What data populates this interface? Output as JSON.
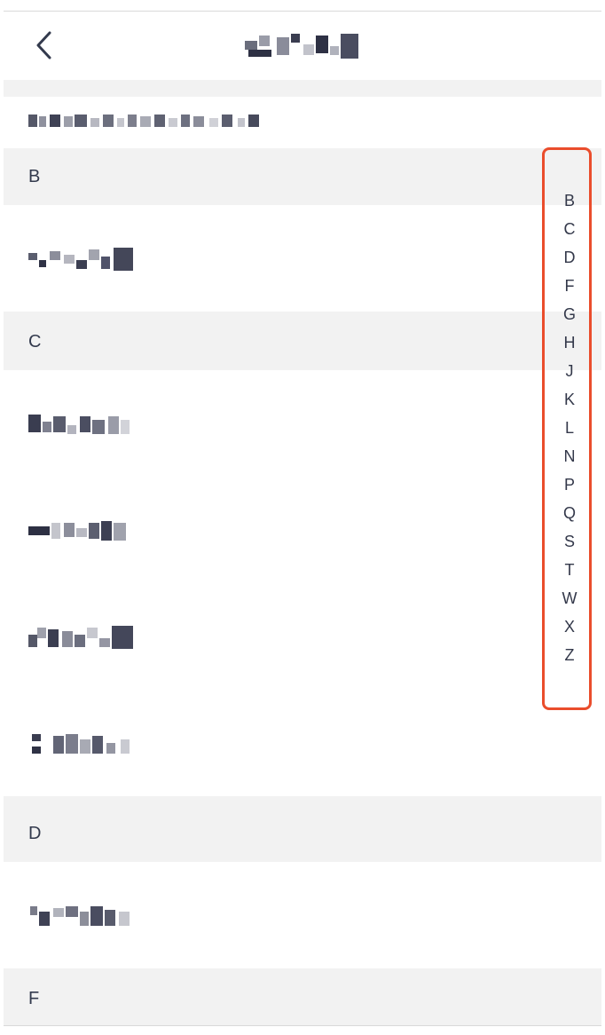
{
  "colors": {
    "page_background": "#ffffff",
    "section_background": "#f2f2f2",
    "text": "#333a4d",
    "highlight_border": "#ea4d2c"
  },
  "header": {
    "back_icon": "chevron-left-icon",
    "title_redacted": true
  },
  "search": {
    "text_redacted": true
  },
  "sections": [
    {
      "letter": "B",
      "item_count": 1
    },
    {
      "letter": "C",
      "item_count": 4
    },
    {
      "letter": "D",
      "item_count": 1
    },
    {
      "letter": "F",
      "item_count": 0
    }
  ],
  "index_bar": {
    "letters": [
      "B",
      "C",
      "D",
      "F",
      "G",
      "H",
      "J",
      "K",
      "L",
      "N",
      "P",
      "Q",
      "S",
      "T",
      "W",
      "X",
      "Z"
    ],
    "highlighted": true
  }
}
